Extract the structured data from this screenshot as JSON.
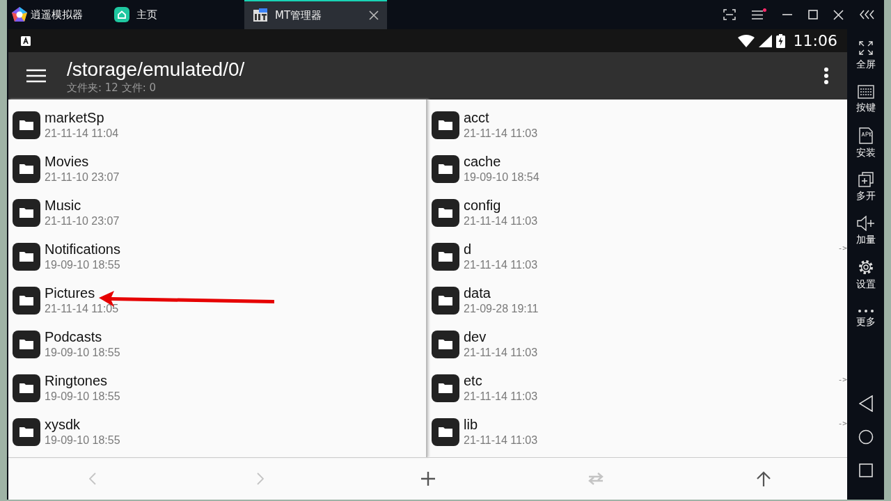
{
  "window": {
    "app_name": "逍遥模拟器",
    "tabs": [
      {
        "label": "主页",
        "kind": "home",
        "selected": false
      },
      {
        "label": "MT管理器",
        "kind": "mt",
        "selected": true
      }
    ],
    "notification_dot": true
  },
  "status_bar": {
    "time": "11:06"
  },
  "app_bar": {
    "path": "/storage/emulated/0/",
    "summary": "文件夹: 12  文件: 0"
  },
  "left_pane": {
    "items": [
      {
        "name": "marketSp",
        "date": "21-11-14 11:04",
        "annotation_arrow": false
      },
      {
        "name": "Movies",
        "date": "21-11-10 23:07",
        "annotation_arrow": false
      },
      {
        "name": "Music",
        "date": "21-11-10 23:07",
        "annotation_arrow": false
      },
      {
        "name": "Notifications",
        "date": "19-09-10 18:55",
        "annotation_arrow": false
      },
      {
        "name": "Pictures",
        "date": "21-11-14 11:05",
        "annotation_arrow": true
      },
      {
        "name": "Podcasts",
        "date": "19-09-10 18:55",
        "annotation_arrow": false
      },
      {
        "name": "Ringtones",
        "date": "19-09-10 18:55",
        "annotation_arrow": false
      },
      {
        "name": "xysdk",
        "date": "19-09-10 18:55",
        "annotation_arrow": false
      }
    ]
  },
  "right_pane": {
    "items": [
      {
        "name": "acct",
        "date": "21-11-14 11:03"
      },
      {
        "name": "cache",
        "date": "19-09-10 18:54"
      },
      {
        "name": "config",
        "date": "21-11-14 11:03"
      },
      {
        "name": "d",
        "date": "21-11-14 11:03",
        "link_mark": "->"
      },
      {
        "name": "data",
        "date": "21-09-28 19:11"
      },
      {
        "name": "dev",
        "date": "21-11-14 11:03"
      },
      {
        "name": "etc",
        "date": "21-11-14 11:03",
        "link_mark": "->"
      },
      {
        "name": "lib",
        "date": "21-11-14 11:03",
        "link_mark": "->"
      }
    ]
  },
  "bottom_bar": [
    {
      "kind": "back",
      "disabled": true
    },
    {
      "kind": "forward",
      "disabled": true
    },
    {
      "kind": "add",
      "disabled": false
    },
    {
      "kind": "swap",
      "disabled": true
    },
    {
      "kind": "up",
      "disabled": false
    }
  ],
  "side_toolbar": [
    {
      "kind": "fullscreen",
      "label": "全屏"
    },
    {
      "kind": "keyboard",
      "label": "按键"
    },
    {
      "kind": "apk",
      "label": "安装"
    },
    {
      "kind": "multi",
      "label": "多开"
    },
    {
      "kind": "volume",
      "label": "加量"
    },
    {
      "kind": "settings",
      "label": "设置"
    },
    {
      "kind": "more",
      "label": "更多"
    }
  ],
  "nav_buttons": [
    {
      "kind": "back"
    },
    {
      "kind": "home"
    },
    {
      "kind": "recents"
    }
  ]
}
